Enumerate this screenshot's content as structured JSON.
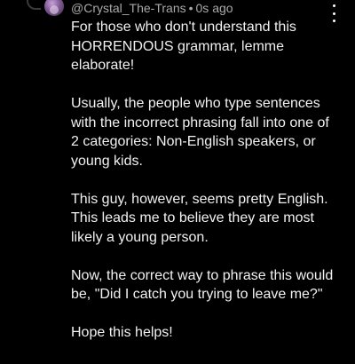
{
  "comment": {
    "author": "@Crystal_The-Trans",
    "separator": "•",
    "time": "0s ago",
    "paragraphs": [
      "For those who don't understand this\nHORRENDOUS grammar, lemme\nelaborate!",
      "Usually, the people who type sentences\nwith the incorrect phrasing fall into one of\n2 categories: Non-English speakers, or\nyoung kids.",
      "This guy, however, seems pretty English.\nThis leads me to believe they are most\nlikely a young person.",
      "Now, the correct way to phrase this would\nbe, \"Did I catch you trying to leave me?\"",
      "Hope this helps!"
    ]
  },
  "icons": {
    "menu": "more-vert-icon",
    "avatar": "user-avatar"
  },
  "colors": {
    "background": "#000000",
    "text": "#f1f1f1",
    "meta": "#aaaaaa"
  }
}
